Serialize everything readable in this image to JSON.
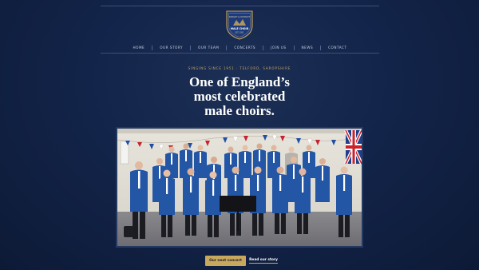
{
  "logo": {
    "icon": "choir-crest-icon",
    "text_top": "DAWLEY & DISTRICT",
    "text_mid": "MALE CHOIR",
    "text_bottom": "EST. 1951"
  },
  "nav": {
    "items": [
      {
        "label": "HOME"
      },
      {
        "label": "OUR STORY"
      },
      {
        "label": "OUR TEAM"
      },
      {
        "label": "CONCERTS"
      },
      {
        "label": "JOIN US"
      },
      {
        "label": "NEWS"
      },
      {
        "label": "CONTACT"
      }
    ]
  },
  "hero": {
    "tagline": "SINGING SINCE 1951 · TELFORD, SHROPSHIRE",
    "headline": "One of England’s\nmost celebrated\nmale choirs."
  },
  "photo": {
    "subject": "choir-group-photo"
  },
  "cta": {
    "primary_label": "Our next concert",
    "secondary_label": "Read our story"
  },
  "colors": {
    "background": "#13244a",
    "accent_gold": "#c9a75c",
    "blazer_blue": "#2456a6",
    "text_white": "#ffffff"
  }
}
